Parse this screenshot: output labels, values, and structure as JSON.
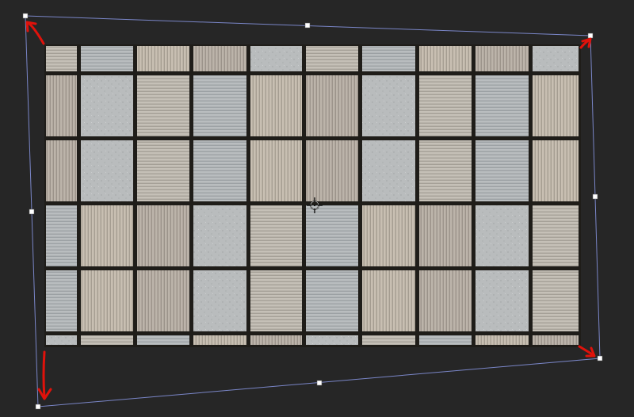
{
  "editor": {
    "mode": "free-transform-perspective",
    "background_color": "#262626",
    "bounding_box_color": "#7a86c8",
    "handle_color": "#ffffff",
    "arrow_color": "#e0120b"
  },
  "image_layer": {
    "subject": "tile-grid",
    "columns": 10,
    "rows": 5,
    "grout_color": "#1f1d19",
    "tile_colors": [
      "#bfbcb5",
      "#c2b7a8",
      "#b8bcbf",
      "#c9c0b3"
    ]
  },
  "transform_handles": [
    "top-left-handle",
    "top-middle-handle",
    "top-right-handle",
    "middle-left-handle",
    "middle-right-handle",
    "bottom-left-handle",
    "bottom-middle-handle",
    "bottom-right-handle"
  ],
  "reference_point": "pivot-crosshair-icon",
  "annotations": [
    "top-left-arrow",
    "top-right-arrow",
    "bottom-left-arrow",
    "bottom-right-arrow"
  ]
}
